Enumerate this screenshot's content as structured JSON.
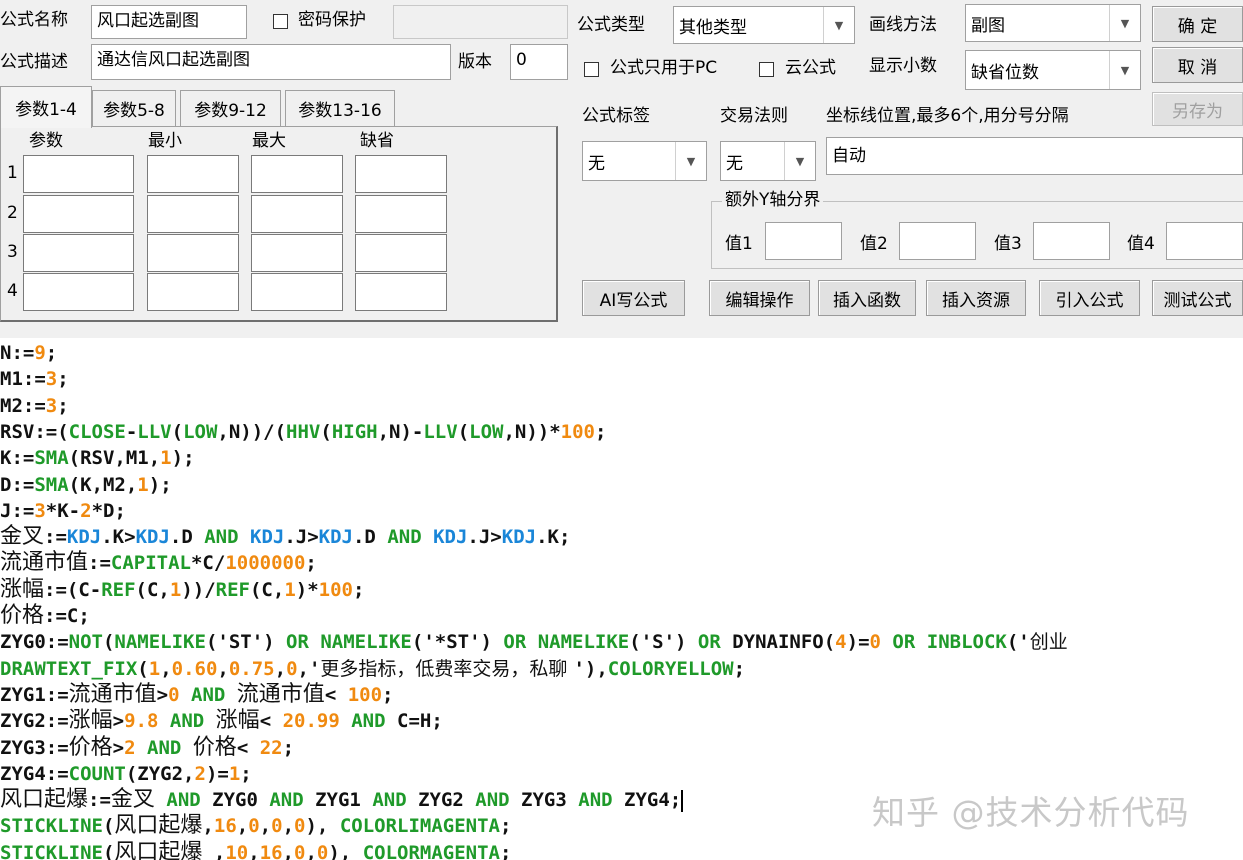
{
  "form": {
    "name_label": "公式名称",
    "name_value": "风口起选副图",
    "password_label": "密码保护",
    "desc_label": "公式描述",
    "desc_value": "通达信风口起选副图",
    "version_label": "版本",
    "version_value": "0"
  },
  "tabs": [
    "参数1-4",
    "参数5-8",
    "参数9-12",
    "参数13-16"
  ],
  "params": {
    "headers": [
      "参数",
      "最小",
      "最大",
      "缺省"
    ],
    "rows": [
      "1",
      "2",
      "3",
      "4"
    ]
  },
  "right": {
    "type_label": "公式类型",
    "type_value": "其他类型",
    "draw_label": "画线方法",
    "draw_value": "副图",
    "pc_only_label": "公式只用于PC",
    "cloud_label": "云公式",
    "decimals_label": "显示小数",
    "decimals_value": "缺省位数",
    "tag_label": "公式标签",
    "tag_value": "无",
    "rule_label": "交易法则",
    "rule_value": "无",
    "coord_label": "坐标线位置,最多6个,用分号分隔",
    "coord_value": "自动",
    "yaxis_group": "额外Y轴分界",
    "val1": "值1",
    "val2": "值2",
    "val3": "值3",
    "val4": "值4"
  },
  "buttons": {
    "ok": "确 定",
    "cancel": "取 消",
    "saveas": "另存为",
    "ai": "AI写公式",
    "edit": "编辑操作",
    "insert_fn": "插入函数",
    "insert_res": "插入资源",
    "import": "引入公式",
    "test": "测试公式"
  },
  "code_lines": [
    [
      [
        "k",
        "N:="
      ],
      [
        "n",
        "9"
      ],
      [
        "k",
        ";"
      ]
    ],
    [
      [
        "k",
        "M1:="
      ],
      [
        "n",
        "3"
      ],
      [
        "k",
        ";"
      ]
    ],
    [
      [
        "k",
        "M2:="
      ],
      [
        "n",
        "3"
      ],
      [
        "k",
        ";"
      ]
    ],
    [
      [
        "k",
        "RSV:=("
      ],
      [
        "f",
        "CLOSE"
      ],
      [
        "k",
        "-"
      ],
      [
        "f",
        "LLV"
      ],
      [
        "k",
        "("
      ],
      [
        "f",
        "LOW"
      ],
      [
        "k",
        ",N))/("
      ],
      [
        "f",
        "HHV"
      ],
      [
        "k",
        "("
      ],
      [
        "f",
        "HIGH"
      ],
      [
        "k",
        ",N)-"
      ],
      [
        "f",
        "LLV"
      ],
      [
        "k",
        "("
      ],
      [
        "f",
        "LOW"
      ],
      [
        "k",
        ",N))*"
      ],
      [
        "n",
        "100"
      ],
      [
        "k",
        ";"
      ]
    ],
    [
      [
        "k",
        "K:="
      ],
      [
        "f",
        "SMA"
      ],
      [
        "k",
        "(RSV,M1,"
      ],
      [
        "n",
        "1"
      ],
      [
        "k",
        ");"
      ]
    ],
    [
      [
        "k",
        "D:="
      ],
      [
        "f",
        "SMA"
      ],
      [
        "k",
        "(K,M2,"
      ],
      [
        "n",
        "1"
      ],
      [
        "k",
        ");"
      ]
    ],
    [
      [
        "k",
        "J:="
      ],
      [
        "n",
        "3"
      ],
      [
        "k",
        "*K-"
      ],
      [
        "n",
        "2"
      ],
      [
        "k",
        "*D;"
      ]
    ],
    [
      [
        "z",
        "金叉"
      ],
      [
        "k",
        ":="
      ],
      [
        "b",
        "KDJ"
      ],
      [
        "k",
        ".K>"
      ],
      [
        "b",
        "KDJ"
      ],
      [
        "k",
        ".D "
      ],
      [
        "f",
        "AND"
      ],
      [
        "k",
        " "
      ],
      [
        "b",
        "KDJ"
      ],
      [
        "k",
        ".J>"
      ],
      [
        "b",
        "KDJ"
      ],
      [
        "k",
        ".D "
      ],
      [
        "f",
        "AND"
      ],
      [
        "k",
        " "
      ],
      [
        "b",
        "KDJ"
      ],
      [
        "k",
        ".J>"
      ],
      [
        "b",
        "KDJ"
      ],
      [
        "k",
        ".K;"
      ]
    ],
    [
      [
        "z",
        "流通市值"
      ],
      [
        "k",
        ":="
      ],
      [
        "f",
        "CAPITAL"
      ],
      [
        "k",
        "*C/"
      ],
      [
        "n",
        "1000000"
      ],
      [
        "k",
        ";"
      ]
    ],
    [
      [
        "z",
        "涨幅"
      ],
      [
        "k",
        ":=(C-"
      ],
      [
        "f",
        "REF"
      ],
      [
        "k",
        "(C,"
      ],
      [
        "n",
        "1"
      ],
      [
        "k",
        "))/"
      ],
      [
        "f",
        "REF"
      ],
      [
        "k",
        "(C,"
      ],
      [
        "n",
        "1"
      ],
      [
        "k",
        ")*"
      ],
      [
        "n",
        "100"
      ],
      [
        "k",
        ";"
      ]
    ],
    [
      [
        "z",
        "价格"
      ],
      [
        "k",
        ":=C;"
      ]
    ],
    [
      [
        "k",
        "ZYG0:="
      ],
      [
        "f",
        "NOT"
      ],
      [
        "k",
        "("
      ],
      [
        "f",
        "NAMELIKE"
      ],
      [
        "k",
        "('ST') "
      ],
      [
        "f",
        "OR"
      ],
      [
        "k",
        " "
      ],
      [
        "f",
        "NAMELIKE"
      ],
      [
        "k",
        "('*ST') "
      ],
      [
        "f",
        "OR"
      ],
      [
        "k",
        " "
      ],
      [
        "f",
        "NAMELIKE"
      ],
      [
        "k",
        "('S') "
      ],
      [
        "f",
        "OR"
      ],
      [
        "k",
        " DYNAINFO("
      ],
      [
        "n",
        "4"
      ],
      [
        "k",
        ")="
      ],
      [
        "n",
        "0"
      ],
      [
        "k",
        " "
      ],
      [
        "f",
        "OR"
      ],
      [
        "k",
        " "
      ],
      [
        "f",
        "INBLOCK"
      ],
      [
        "k",
        "('"
      ],
      [
        "s",
        "创业"
      ]
    ],
    [
      [
        "f",
        "DRAWTEXT_FIX"
      ],
      [
        "k",
        "("
      ],
      [
        "n",
        "1"
      ],
      [
        "k",
        ","
      ],
      [
        "n",
        "0.60"
      ],
      [
        "k",
        ","
      ],
      [
        "n",
        "0.75"
      ],
      [
        "k",
        ","
      ],
      [
        "n",
        "0"
      ],
      [
        "k",
        ",'"
      ],
      [
        "s",
        "更多指标，低费率交易，私聊 "
      ],
      [
        "k",
        "'),"
      ],
      [
        "f",
        "COLORYELLOW"
      ],
      [
        "k",
        ";"
      ]
    ],
    [
      [
        "k",
        "ZYG1:="
      ],
      [
        "z",
        "流通市值"
      ],
      [
        "k",
        ">"
      ],
      [
        "n",
        "0"
      ],
      [
        "k",
        " "
      ],
      [
        "f",
        "AND"
      ],
      [
        "k",
        " "
      ],
      [
        "z",
        "流通市值"
      ],
      [
        "k",
        "< "
      ],
      [
        "n",
        "100"
      ],
      [
        "k",
        ";"
      ]
    ],
    [
      [
        "k",
        "ZYG2:="
      ],
      [
        "z",
        "涨幅"
      ],
      [
        "k",
        ">"
      ],
      [
        "n",
        "9.8"
      ],
      [
        "k",
        " "
      ],
      [
        "f",
        "AND"
      ],
      [
        "k",
        " "
      ],
      [
        "z",
        "涨幅"
      ],
      [
        "k",
        "< "
      ],
      [
        "n",
        "20.99"
      ],
      [
        "k",
        " "
      ],
      [
        "f",
        "AND"
      ],
      [
        "k",
        " C=H;"
      ]
    ],
    [
      [
        "k",
        "ZYG3:="
      ],
      [
        "z",
        "价格"
      ],
      [
        "k",
        ">"
      ],
      [
        "n",
        "2"
      ],
      [
        "k",
        " "
      ],
      [
        "f",
        "AND"
      ],
      [
        "k",
        " "
      ],
      [
        "z",
        "价格"
      ],
      [
        "k",
        "< "
      ],
      [
        "n",
        "22"
      ],
      [
        "k",
        ";"
      ]
    ],
    [
      [
        "k",
        "ZYG4:="
      ],
      [
        "f",
        "COUNT"
      ],
      [
        "k",
        "(ZYG2,"
      ],
      [
        "n",
        "2"
      ],
      [
        "k",
        ")="
      ],
      [
        "n",
        "1"
      ],
      [
        "k",
        ";"
      ]
    ],
    [
      [
        "z",
        "风口起爆"
      ],
      [
        "k",
        ":="
      ],
      [
        "z",
        "金叉"
      ],
      [
        "k",
        " "
      ],
      [
        "f",
        "AND"
      ],
      [
        "k",
        " ZYG0 "
      ],
      [
        "f",
        "AND"
      ],
      [
        "k",
        " ZYG1 "
      ],
      [
        "f",
        "AND"
      ],
      [
        "k",
        " ZYG2 "
      ],
      [
        "f",
        "AND"
      ],
      [
        "k",
        " ZYG3 "
      ],
      [
        "f",
        "AND"
      ],
      [
        "k",
        " ZYG4;"
      ],
      [
        "c",
        ""
      ]
    ],
    [
      [
        "f",
        "STICKLINE"
      ],
      [
        "k",
        "("
      ],
      [
        "z",
        "风口起爆"
      ],
      [
        "k",
        ","
      ],
      [
        "n",
        "16"
      ],
      [
        "k",
        ","
      ],
      [
        "n",
        "0"
      ],
      [
        "k",
        ","
      ],
      [
        "n",
        "0"
      ],
      [
        "k",
        ","
      ],
      [
        "n",
        "0"
      ],
      [
        "k",
        "), "
      ],
      [
        "f",
        "COLORLIMAGENTA"
      ],
      [
        "k",
        ";"
      ]
    ],
    [
      [
        "f",
        "STICKLINE"
      ],
      [
        "k",
        "("
      ],
      [
        "z",
        "风口起爆"
      ],
      [
        "k",
        " ,"
      ],
      [
        "n",
        "10"
      ],
      [
        "k",
        ","
      ],
      [
        "n",
        "16"
      ],
      [
        "k",
        ","
      ],
      [
        "n",
        "0"
      ],
      [
        "k",
        ","
      ],
      [
        "n",
        "0"
      ],
      [
        "k",
        "), "
      ],
      [
        "f",
        "COLORMAGENTA"
      ],
      [
        "k",
        ";"
      ]
    ]
  ],
  "watermark": "知乎 @技术分析代码"
}
